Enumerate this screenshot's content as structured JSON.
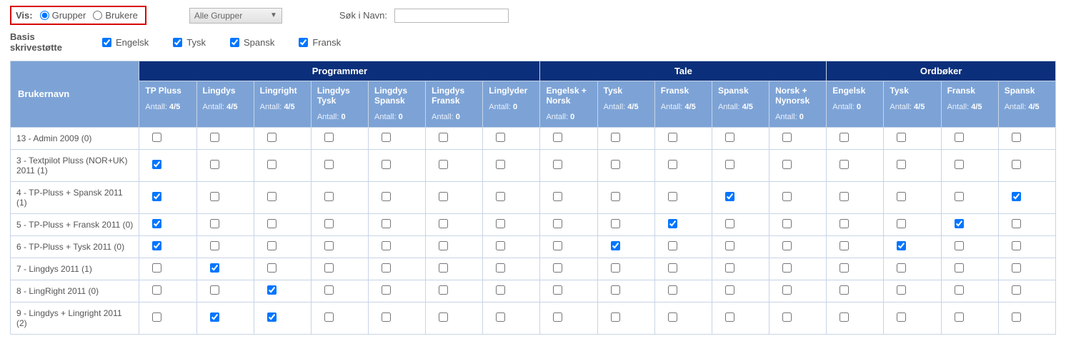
{
  "filters": {
    "vis_label": "Vis:",
    "radio_grupper": "Grupper",
    "radio_brukere": "Brukere",
    "dropdown_value": "Alle Grupper",
    "search_label": "Søk i Navn:",
    "search_value": ""
  },
  "basis": {
    "label": "Basis skrivestøtte",
    "engelsk": "Engelsk",
    "tysk": "Tysk",
    "spansk": "Spansk",
    "fransk": "Fransk"
  },
  "groups": {
    "programmer": "Programmer",
    "tale": "Tale",
    "ordboker": "Ordbøker"
  },
  "cols": {
    "brukernavn": "Brukernavn",
    "antall_word": "Antall:",
    "tp_pluss": {
      "label": "TP Pluss",
      "antall": "4/5"
    },
    "lingdys": {
      "label": "Lingdys",
      "antall": "4/5"
    },
    "lingright": {
      "label": "Lingright",
      "antall": "4/5"
    },
    "lingdys_tysk": {
      "label": "Lingdys Tysk",
      "antall": "0"
    },
    "lingdys_spansk": {
      "label": "Lingdys Spansk",
      "antall": "0"
    },
    "lingdys_fransk": {
      "label": "Lingdys Fransk",
      "antall": "0"
    },
    "linglyder": {
      "label": "Linglyder",
      "antall": "0"
    },
    "engelsk_norsk": {
      "label": "Engelsk + Norsk",
      "antall": "0"
    },
    "tysk": {
      "label": "Tysk",
      "antall": "4/5"
    },
    "fransk": {
      "label": "Fransk",
      "antall": "4/5"
    },
    "spansk": {
      "label": "Spansk",
      "antall": "4/5"
    },
    "norsk_nynorsk": {
      "label": "Norsk + Nynorsk",
      "antall": "0"
    },
    "ob_engelsk": {
      "label": "Engelsk",
      "antall": "0"
    },
    "ob_tysk": {
      "label": "Tysk",
      "antall": "4/5"
    },
    "ob_fransk": {
      "label": "Fransk",
      "antall": "4/5"
    },
    "ob_spansk": {
      "label": "Spansk",
      "antall": "4/5"
    }
  },
  "rows": [
    {
      "name": "13 - Admin 2009 (0)",
      "chk": [
        0,
        0,
        0,
        0,
        0,
        0,
        0,
        0,
        0,
        0,
        0,
        0,
        0,
        0,
        0,
        0
      ]
    },
    {
      "name": "3 - Textpilot Pluss (NOR+UK) 2011 (1)",
      "chk": [
        1,
        0,
        0,
        0,
        0,
        0,
        0,
        0,
        0,
        0,
        0,
        0,
        0,
        0,
        0,
        0
      ]
    },
    {
      "name": "4 - TP-Pluss + Spansk 2011 (1)",
      "chk": [
        1,
        0,
        0,
        0,
        0,
        0,
        0,
        0,
        0,
        0,
        1,
        0,
        0,
        0,
        0,
        1
      ]
    },
    {
      "name": "5 - TP-Pluss + Fransk 2011 (0)",
      "chk": [
        1,
        0,
        0,
        0,
        0,
        0,
        0,
        0,
        0,
        1,
        0,
        0,
        0,
        0,
        1,
        0
      ]
    },
    {
      "name": "6 - TP-Pluss + Tysk 2011 (0)",
      "chk": [
        1,
        0,
        0,
        0,
        0,
        0,
        0,
        0,
        1,
        0,
        0,
        0,
        0,
        1,
        0,
        0
      ]
    },
    {
      "name": "7 - Lingdys 2011 (1)",
      "chk": [
        0,
        1,
        0,
        0,
        0,
        0,
        0,
        0,
        0,
        0,
        0,
        0,
        0,
        0,
        0,
        0
      ]
    },
    {
      "name": "8 - LingRight 2011 (0)",
      "chk": [
        0,
        0,
        1,
        0,
        0,
        0,
        0,
        0,
        0,
        0,
        0,
        0,
        0,
        0,
        0,
        0
      ]
    },
    {
      "name": "9 - Lingdys + Lingright 2011 (2)",
      "chk": [
        0,
        1,
        1,
        0,
        0,
        0,
        0,
        0,
        0,
        0,
        0,
        0,
        0,
        0,
        0,
        0
      ]
    }
  ]
}
